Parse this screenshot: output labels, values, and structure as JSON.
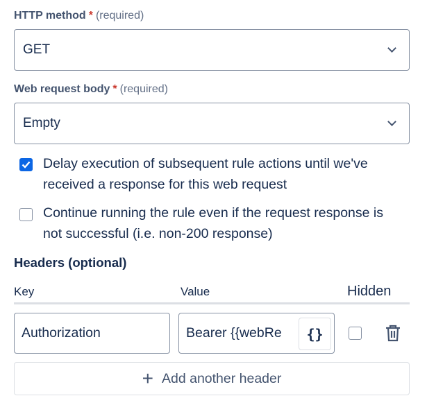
{
  "http_method": {
    "label": "HTTP method",
    "required_mark": "*",
    "required_text": "(required)",
    "value": "GET"
  },
  "body": {
    "label": "Web request body",
    "required_mark": "*",
    "required_text": "(required)",
    "value": "Empty"
  },
  "options": [
    {
      "text": "Delay execution of subsequent rule actions until we've received a response for this web request",
      "checked": true
    },
    {
      "text": "Continue running the rule even if the request response is not successful (i.e. non-200 response)",
      "checked": false
    }
  ],
  "headers": {
    "title": "Headers (optional)",
    "columns": [
      "Key",
      "Value",
      "Hidden"
    ],
    "rows": [
      {
        "key": "Authorization",
        "value": "Bearer {{webRe",
        "hidden": false
      }
    ],
    "smart_value_button": "{}",
    "add_label": "Add another header"
  },
  "colors": {
    "accent": "#0c66e4",
    "required": "#c9372c"
  }
}
